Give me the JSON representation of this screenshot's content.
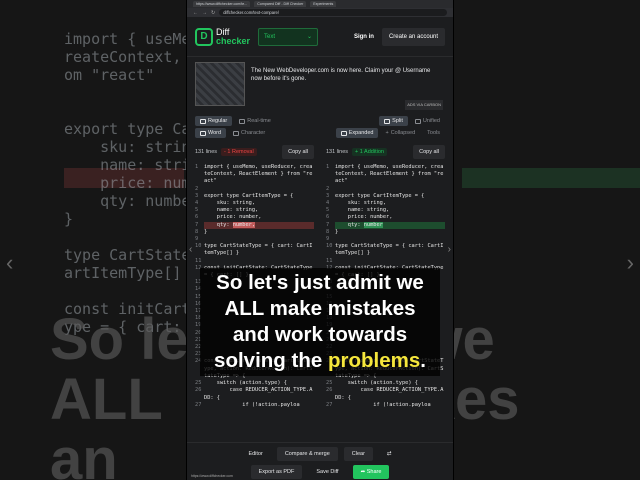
{
  "browser": {
    "tabs": [
      "https://www.diffchecker.com/te...",
      "Compared Diff - Diff Checker",
      "Experiments"
    ],
    "url": "diffchecker.com/text-compare/"
  },
  "header": {
    "logo_mark": "D",
    "logo_text_1": "Diff",
    "logo_text_2": "checker",
    "type_select": "Text",
    "signin": "Sign in",
    "create_account": "Create an account"
  },
  "ad": {
    "text": "The New WebDeveloper.com is now here. Claim your @ Username now before it's gone.",
    "via": "ADS VIA CARBON"
  },
  "toolbar": {
    "regular": "Regular",
    "realtime": "Real-time",
    "split": "Split",
    "unified": "Unified",
    "word": "Word",
    "character": "Character",
    "expanded": "Expanded",
    "collapsed": "Collapsed",
    "tools": "Tools"
  },
  "left_pane": {
    "lines": "131 lines",
    "badge": "- 1 Removal",
    "copy": "Copy all"
  },
  "right_pane": {
    "lines": "131 lines",
    "badge": "+ 1 Addition",
    "copy": "Copy all"
  },
  "code_left": [
    {
      "n": "1",
      "t": "import { useMemo, useReducer, createContext, ReactElement } from \"react\""
    },
    {
      "n": "2",
      "t": ""
    },
    {
      "n": "3",
      "t": "export type CartItemType = {"
    },
    {
      "n": "4",
      "t": "    sku: string,"
    },
    {
      "n": "5",
      "t": "    name: string,"
    },
    {
      "n": "6",
      "t": "    price: number,"
    },
    {
      "n": "7",
      "t": "    qty: ",
      "hl": "number,",
      "kind": "del"
    },
    {
      "n": "8",
      "t": "}"
    },
    {
      "n": "9",
      "t": ""
    },
    {
      "n": "10",
      "t": "type CartStateType = { cart: CartItemType[] }"
    },
    {
      "n": "11",
      "t": ""
    },
    {
      "n": "12",
      "t": "const initCartState: CartStateType = { cart: [] }"
    },
    {
      "n": "13",
      "t": ""
    },
    {
      "n": "14",
      "t": ""
    },
    {
      "n": "15",
      "t": ""
    },
    {
      "n": "16",
      "t": ""
    },
    {
      "n": "17",
      "t": ""
    },
    {
      "n": "18",
      "t": ""
    },
    {
      "n": "19",
      "t": ""
    },
    {
      "n": "20",
      "t": ""
    },
    {
      "n": "21",
      "t": ""
    },
    {
      "n": "22",
      "t": ""
    },
    {
      "n": "23",
      "t": ""
    },
    {
      "n": "24",
      "t": "const reducer = (state: CartStateType, action: ReducerAction): CartStateType => {"
    },
    {
      "n": "25",
      "t": "    switch (action.type) {"
    },
    {
      "n": "26",
      "t": "        case REDUCER_ACTION_TYPE.ADD: {"
    },
    {
      "n": "27",
      "t": "            if (!action.payloa"
    }
  ],
  "code_right": [
    {
      "n": "1",
      "t": "import { useMemo, useReducer, createContext, ReactElement } from \"react\""
    },
    {
      "n": "2",
      "t": ""
    },
    {
      "n": "3",
      "t": "export type CartItemType = {"
    },
    {
      "n": "4",
      "t": "    sku: string,"
    },
    {
      "n": "5",
      "t": "    name: string,"
    },
    {
      "n": "6",
      "t": "    price: number,"
    },
    {
      "n": "7",
      "t": "    qty: ",
      "hl": "number",
      "kind": "add"
    },
    {
      "n": "8",
      "t": "}"
    },
    {
      "n": "9",
      "t": ""
    },
    {
      "n": "10",
      "t": "type CartStateType = { cart: CartItemType[] }"
    },
    {
      "n": "11",
      "t": ""
    },
    {
      "n": "12",
      "t": "const initCartState: CartStateType = { cart: [] }"
    },
    {
      "n": "13",
      "t": ""
    },
    {
      "n": "14",
      "t": ""
    },
    {
      "n": "15",
      "t": ""
    },
    {
      "n": "16",
      "t": ""
    },
    {
      "n": "17",
      "t": ""
    },
    {
      "n": "18",
      "t": ""
    },
    {
      "n": "19",
      "t": ""
    },
    {
      "n": "20",
      "t": ""
    },
    {
      "n": "21",
      "t": ""
    },
    {
      "n": "22",
      "t": ""
    },
    {
      "n": "23",
      "t": ""
    },
    {
      "n": "24",
      "t": "const reducer = (state: CartStateType, action: ReducerAction): CartStateType => {"
    },
    {
      "n": "25",
      "t": "    switch (action.type) {"
    },
    {
      "n": "26",
      "t": "        case REDUCER_ACTION_TYPE.ADD: {"
    },
    {
      "n": "27",
      "t": "            if (!action.payloa"
    }
  ],
  "bottom": {
    "editor": "Editor",
    "compare": "Compare & merge",
    "clear": "Clear",
    "export": "Export as PDF",
    "save": "Save Diff",
    "share": "Share",
    "status": "https://www.diffchecker.com"
  },
  "subtitle": {
    "line1": "So let's just admit we",
    "line2": "ALL make mistakes",
    "line3": "and work towards",
    "line4_pre": "solving the ",
    "line4_hl": "problems",
    "line4_post": "."
  },
  "background": {
    "code": "import { useMemo, useReducer, c\nreateContext, ReactElement } fr\nom \"react\"\n\n\nexport type CartItemType = {\n    sku: string,\n    name: string,\n    price: number,\n    qty: number,\n}\n\ntype CartStateType = { cart: C\nartItemType[] }\n\nconst initCartState: CartStateT\nype = { cart: [] }",
    "big": "So le           it we\nALL           stakes\nan            ards"
  },
  "colors": {
    "accent": "#22c55e",
    "removal": "#ef4444",
    "highlight_word": "#f5e63c"
  }
}
